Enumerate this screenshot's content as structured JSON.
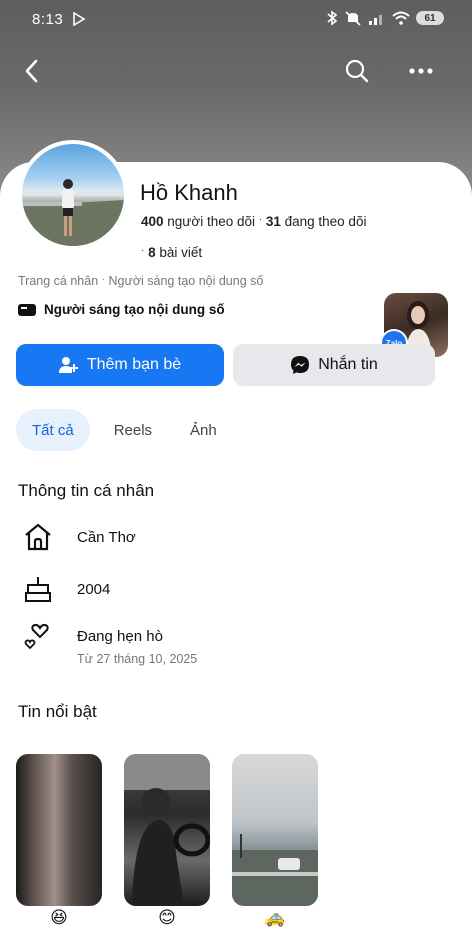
{
  "status_bar": {
    "time": "8:13",
    "battery": "61"
  },
  "profile": {
    "name": "Hồ Khanh",
    "followers_text": "400",
    "followers_label": " người theo dõi ",
    "following_text": "31",
    "following_label": " đang theo dõi",
    "posts_text": "8",
    "posts_label": " bài viết",
    "subline_part1": "Trang cá nhân",
    "subline_part2": "Người sáng tạo nội dung số",
    "creator_label": "Người sáng tạo nội dung số",
    "zalo_label": "Zalo"
  },
  "actions": {
    "add_friend": "Thêm bạn bè",
    "message": "Nhắn tin"
  },
  "tabs": [
    {
      "label": "Tất cả",
      "active": true
    },
    {
      "label": "Reels",
      "active": false
    },
    {
      "label": "Ảnh",
      "active": false
    }
  ],
  "about": {
    "title": "Thông tin cá nhân",
    "city": "Cần Thơ",
    "birth_year": "2004",
    "relationship": "Đang hẹn hò",
    "relationship_since": "Từ 27 tháng 10, 2025"
  },
  "highlights": {
    "title": "Tin nổi bật",
    "items": [
      {
        "emoji": "😆"
      },
      {
        "emoji": "😊"
      },
      {
        "emoji": "🚕"
      }
    ]
  },
  "colors": {
    "primary_blue": "#1877f2",
    "tab_active_bg": "#e7f0fd",
    "tab_active_text": "#1664d8"
  },
  "icons": [
    "back-icon",
    "search-icon",
    "more-icon",
    "home-icon",
    "cake-icon",
    "hearts-icon",
    "messenger-icon",
    "add-friend-icon",
    "video-icon"
  ]
}
